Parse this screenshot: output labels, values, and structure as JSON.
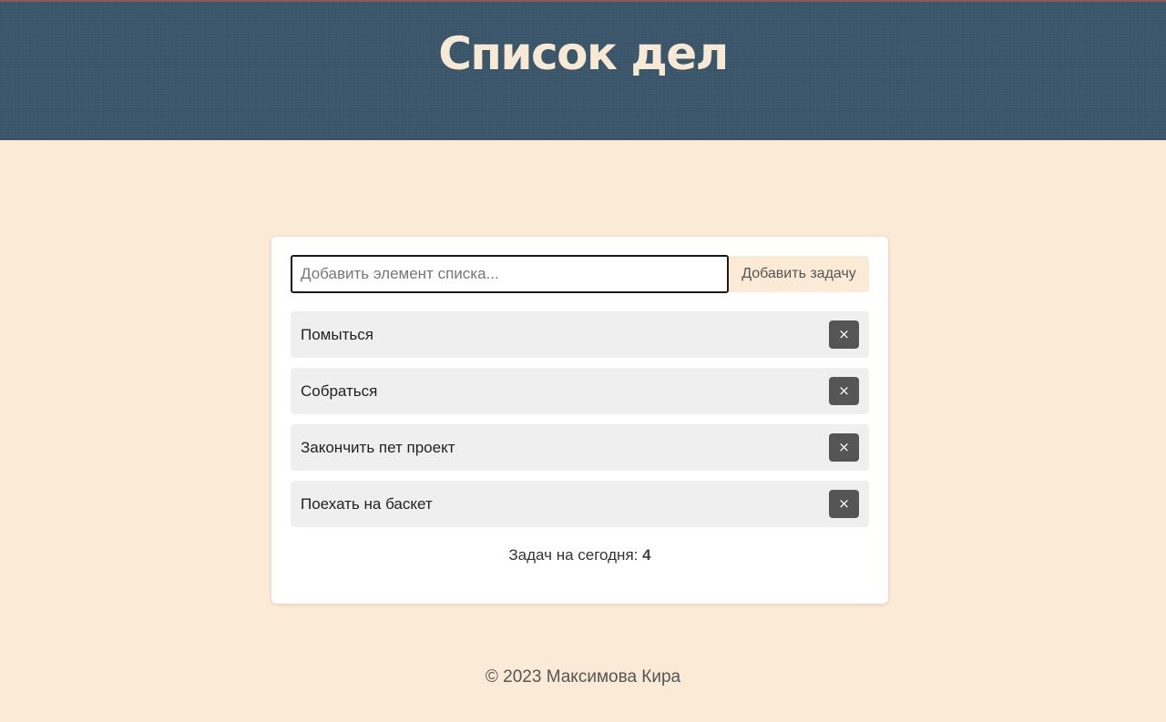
{
  "header": {
    "title": "Список дел"
  },
  "form": {
    "input_placeholder": "Добавить элемент списка...",
    "input_value": "",
    "add_button_label": "Добавить задачу"
  },
  "tasks": [
    {
      "label": "Помыться",
      "delete_icon": "×"
    },
    {
      "label": "Собраться",
      "delete_icon": "×"
    },
    {
      "label": "Закончить пет проект",
      "delete_icon": "×"
    },
    {
      "label": "Поехать на баскет",
      "delete_icon": "×"
    }
  ],
  "counter": {
    "label": "Задач на сегодня:",
    "value": "4"
  },
  "footer": {
    "text": "© 2023 Максимова Кира"
  },
  "colors": {
    "header_bg": "#3b566a",
    "page_bg": "#fbead6",
    "title_color": "#f8e9d4",
    "task_bg": "#efefef",
    "delete_bg": "#555555"
  }
}
